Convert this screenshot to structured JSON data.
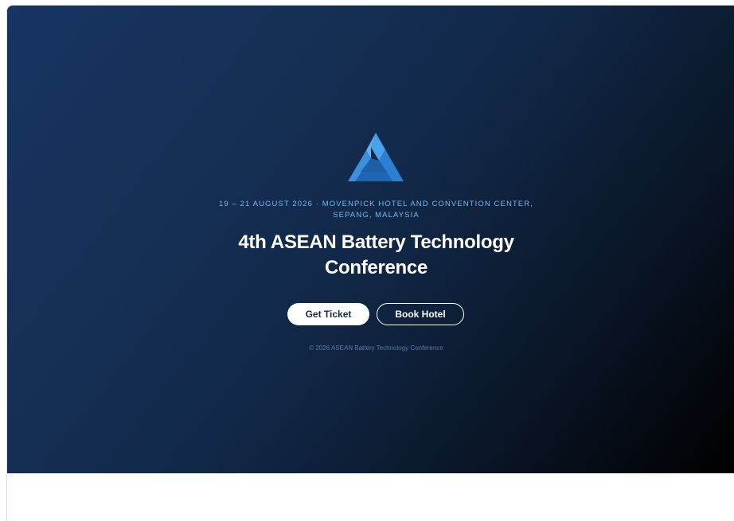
{
  "hero": {
    "logo_icon": "triangle-logo-icon",
    "date_location": "19 – 21 AUGUST 2026 · MOVENPICK HOTEL AND CONVENTION CENTER, SEPANG, MALAYSIA",
    "title": "4th ASEAN Battery Technology Conference",
    "primary_button_label": "Get Ticket",
    "secondary_button_label": "Book Hotel",
    "copyright": "© 2026 ASEAN Battery Technology Conference"
  },
  "colors": {
    "gradient_start": "#173562",
    "gradient_end": "#000000",
    "logo_light": "#3f93de",
    "logo_dark": "#1d66b3",
    "date_text": "#7fb6e6",
    "primary_button_bg": "#ffffff",
    "primary_button_text": "#13294a"
  }
}
